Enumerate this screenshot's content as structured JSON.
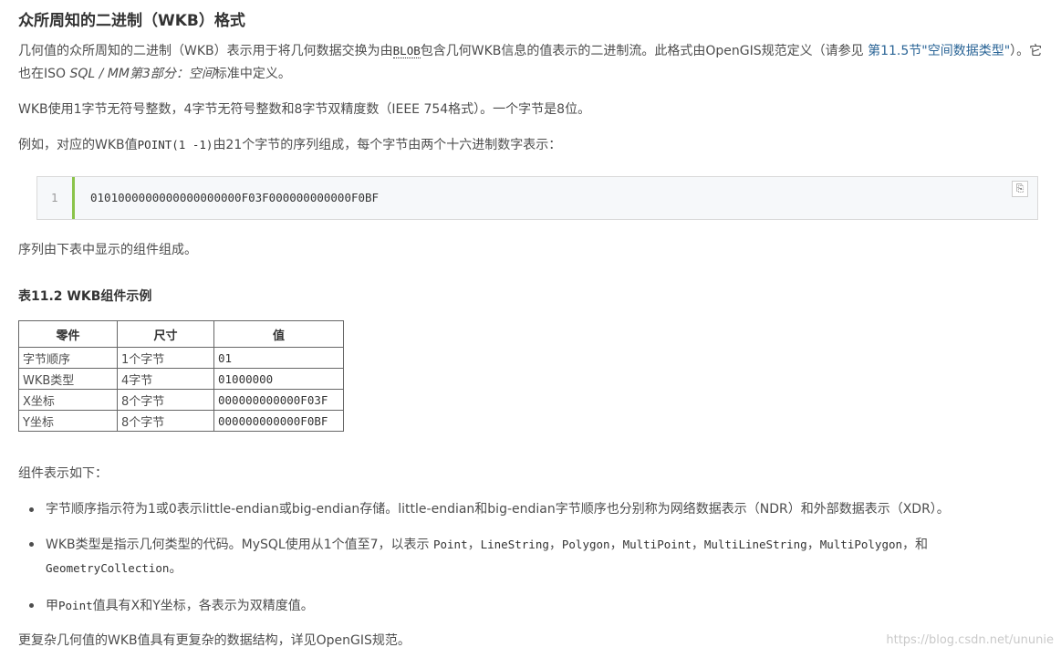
{
  "heading": "众所周知的二进制（WKB）格式",
  "intro": {
    "text1": "几何值的众所周知的二进制（WKB）表示用于将几何数据交换为由",
    "blob": "BLOB",
    "text2": "包含几何WKB信息的值表示的二进制流。此格式由OpenGIS规范定义（请参见 ",
    "link": "第11.5节\"空间数据类型\"",
    "text3": "）。它",
    "line2_a": "也在ISO ",
    "line2_italic": "SQL / MM第3部分：空间",
    "line2_b": "标准中定义。"
  },
  "para2": "WKB使用1字节无符号整数，4字节无符号整数和8字节双精度数（IEEE 754格式）。一个字节是8位。",
  "para3": {
    "a": "例如，对应的WKB值",
    "code": "POINT(1 -1)",
    "b": "由21个字节的序列组成，每个字节由两个十六进制数字表示："
  },
  "codeblock": {
    "line_number": "1",
    "code": "0101000000000000000000F03F000000000000F0BF",
    "copy_icon": "clipboard-icon"
  },
  "para4": "序列由下表中显示的组件组成。",
  "table_caption": "表11.2 WKB组件示例",
  "table": {
    "headers": [
      "零件",
      "尺寸",
      "值"
    ],
    "rows": [
      [
        "字节顺序",
        "1个字节",
        "01"
      ],
      [
        "WKB类型",
        "4字节",
        "01000000"
      ],
      [
        "X坐标",
        "8个字节",
        "000000000000F03F"
      ],
      [
        "Y坐标",
        "8个字节",
        "000000000000F0BF"
      ]
    ]
  },
  "para5": "组件表示如下：",
  "bullets": {
    "b1": "字节顺序指示符为1或0表示little-endian或big-endian存储。little-endian和big-endian字节顺序也分别称为网络数据表示（NDR）和外部数据表示（XDR）。",
    "b2_a": "WKB类型是指示几何类型的代码。MySQL使用从1个值至7，以表示 ",
    "b2_point": "Point",
    "b2_ls": "LineString",
    "b2_poly": "Polygon",
    "b2_mp": "MultiPoint",
    "b2_mls": "MultiLineString",
    "b2_mpoly": "MultiPolygon",
    "b2_and": "，和",
    "b2_gc": "GeometryCollection",
    "b2_end": "。",
    "b3_a": "甲",
    "b3_code": "Point",
    "b3_b": "值具有X和Y坐标，各表示为双精度值。"
  },
  "para6": "更复杂几何值的WKB值具有更复杂的数据结构，详见OpenGIS规范。",
  "watermark": "https://blog.csdn.net/ununie"
}
